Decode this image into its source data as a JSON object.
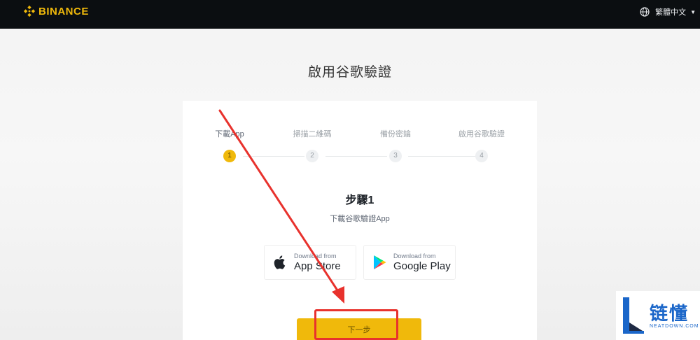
{
  "header": {
    "brand": "BINANCE",
    "language": "繁體中文"
  },
  "page": {
    "title": "啟用谷歌驗證"
  },
  "steps": [
    {
      "label": "下載App",
      "number": "1",
      "active": true
    },
    {
      "label": "掃描二維碼",
      "number": "2",
      "active": false
    },
    {
      "label": "備份密鑰",
      "number": "3",
      "active": false
    },
    {
      "label": "啟用谷歌驗證",
      "number": "4",
      "active": false
    }
  ],
  "content": {
    "heading": "步驟1",
    "subtitle": "下載谷歌驗證App"
  },
  "stores": {
    "app_store": {
      "small": "Download from",
      "big": "App Store"
    },
    "google_play": {
      "small": "Download from",
      "big": "Google Play"
    }
  },
  "actions": {
    "next_label": "下一步"
  },
  "watermark": {
    "cn": "链懂",
    "en": "NEATDOWN.COM"
  },
  "colors": {
    "brand": "#f0b90b",
    "topbar": "#0b0e11",
    "annotation": "#e8322d",
    "watermark": "#1a66c9"
  }
}
